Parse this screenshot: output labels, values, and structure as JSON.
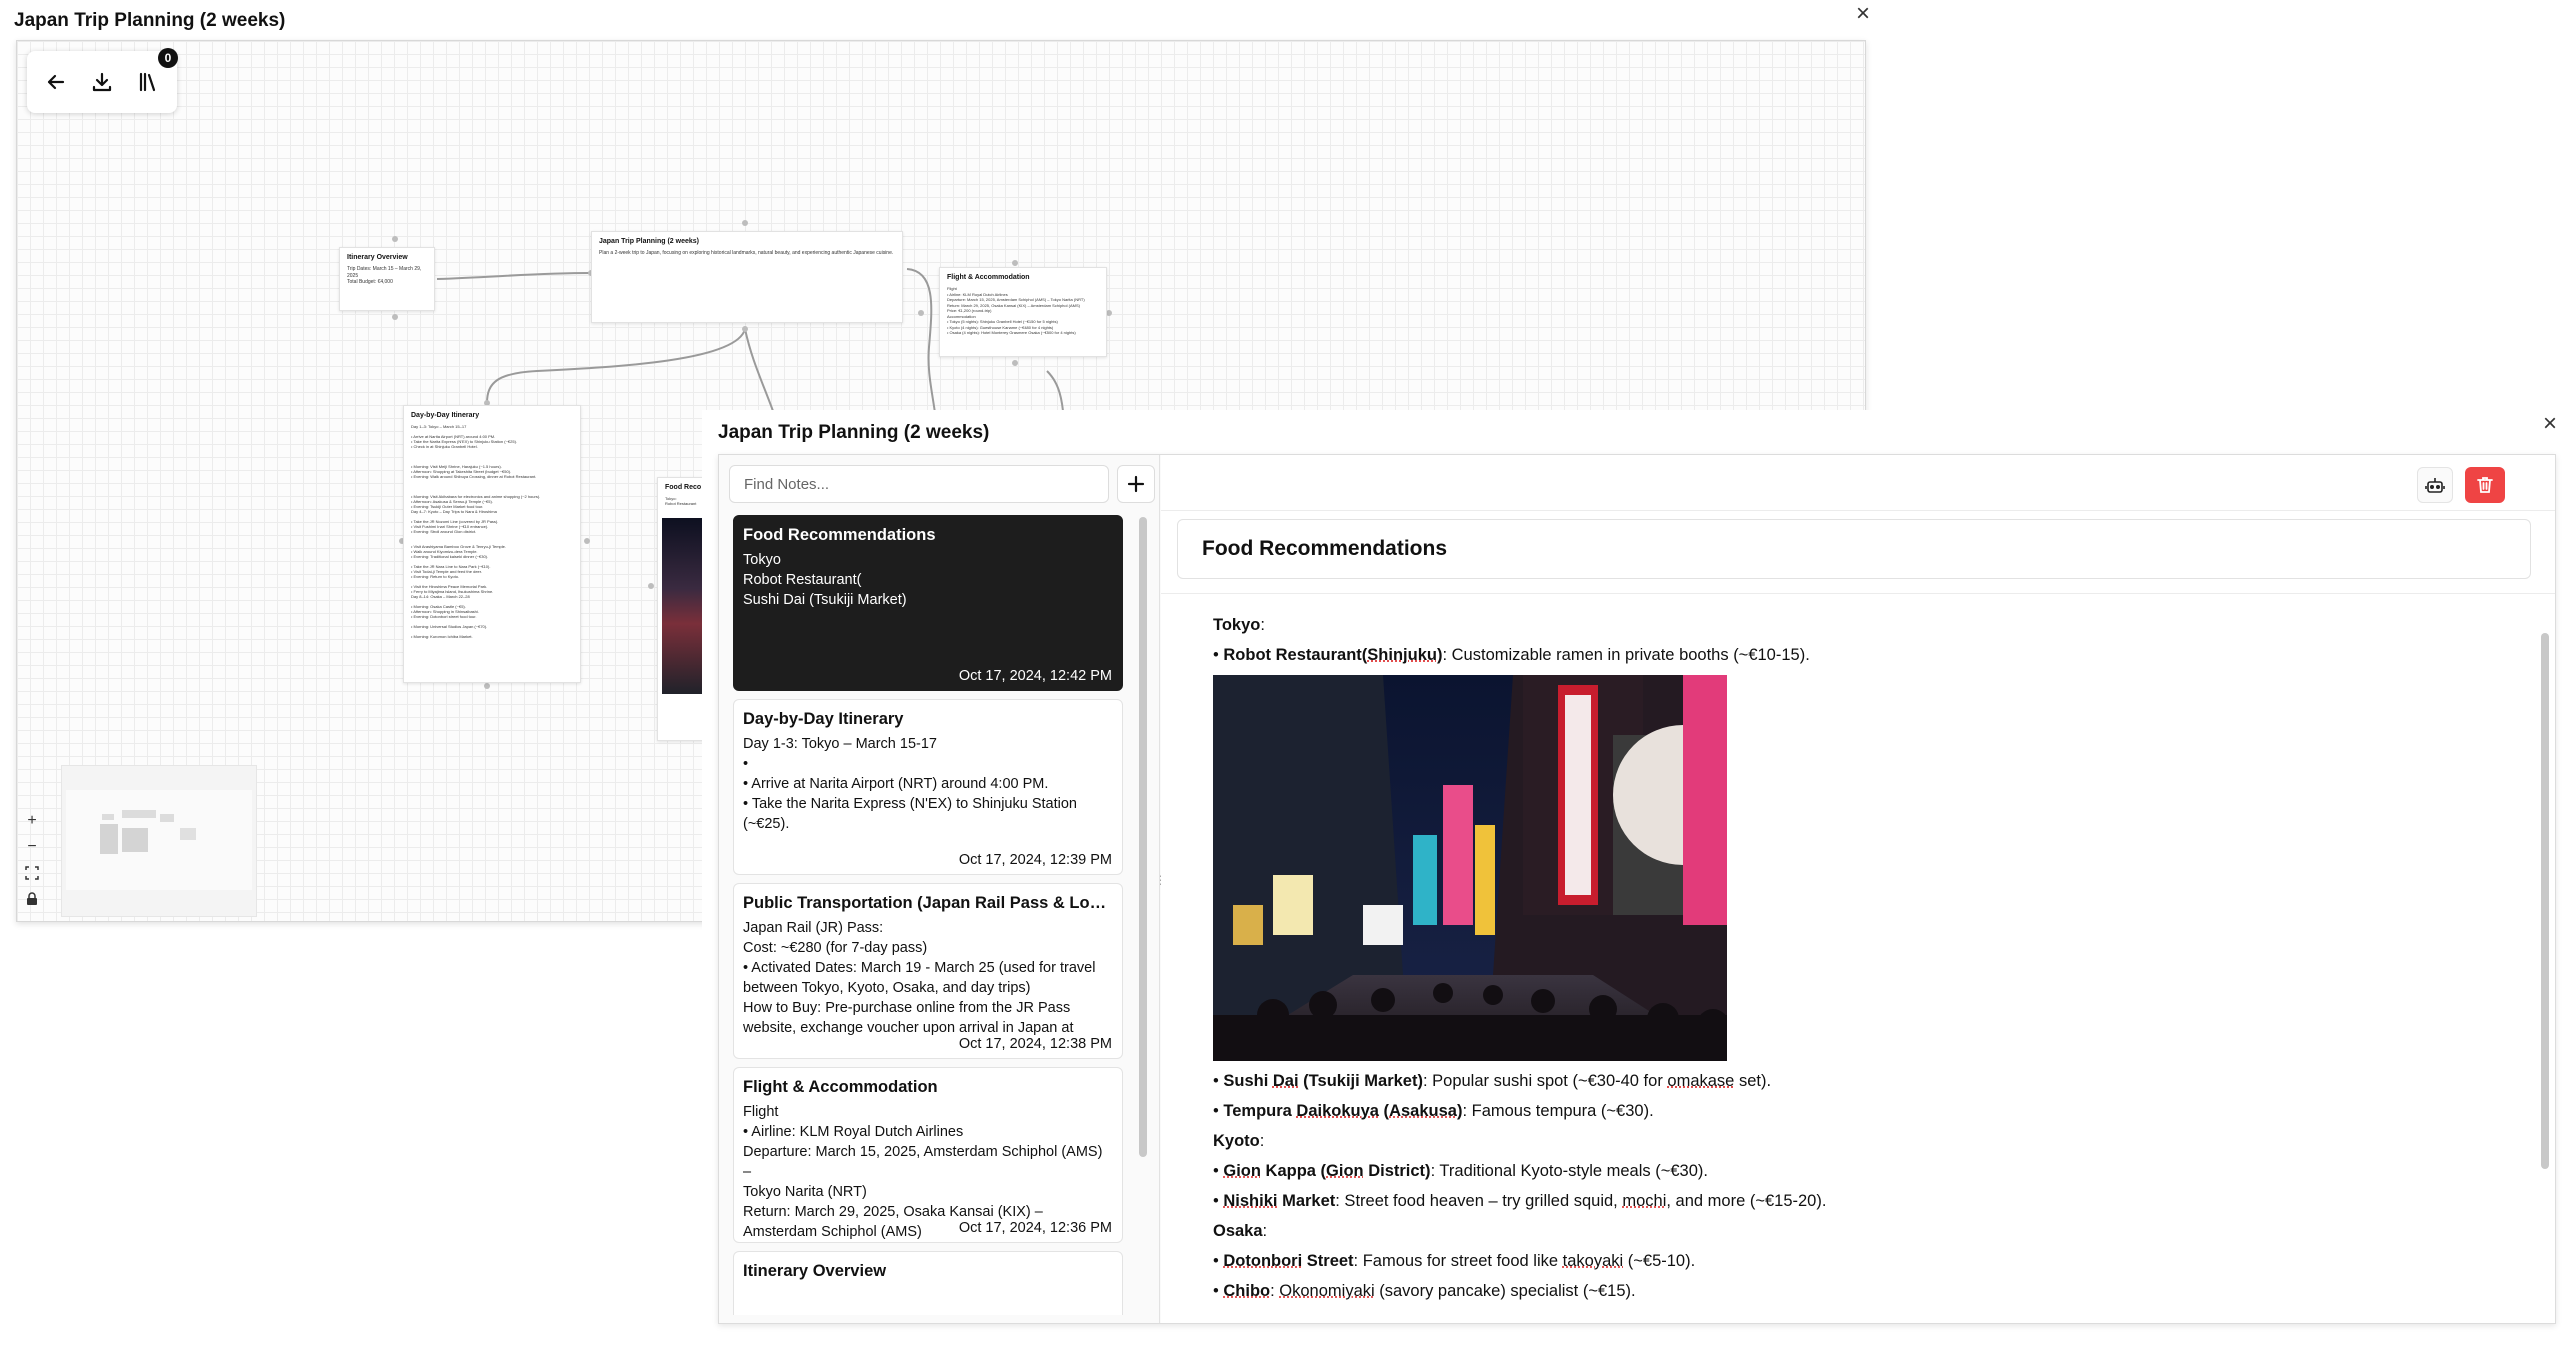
{
  "canvas": {
    "title": "Japan Trip Planning (2 weeks)",
    "close_icon": "×",
    "library_count": "0",
    "nodes": {
      "overview": {
        "title": "Itinerary Overview",
        "body": "Trip Dates: March 15 – March 29, 2025\nTotal Budget: €4,000"
      },
      "main": {
        "title": "Japan Trip Planning (2 weeks)",
        "body": "Plan a 2-week trip to Japan, focusing on exploring historical landmarks, natural beauty, and experiencing authentic Japanese cuisine."
      },
      "flight": {
        "title": "Flight & Accommodation",
        "body": "Flight\n• Airline: KLM Royal Dutch Airlines\nDeparture: March 15, 2025, Amsterdam Schiphol (AMS) – Tokyo Narita (NRT)\nReturn: March 29, 2025, Osaka Kansai (KIX) – Amsterdam Schiphol (AMS)\nPrice: €1,200 (round-trip)\nAccommodation\n• Tokyo (5 nights): Shinjuku Granbell Hotel (~€150 for 5 nights)\n• Kyoto (4 nights): Guesthouse Kaname (~€480 for 4 nights)\n• Osaka (4 nights): Hotel Monterey Grasmere Osaka (~€500 for 4 nights)"
      },
      "daybyday": {
        "title": "Day-by-Day Itinerary",
        "body": "Day 1–3: Tokyo – March 15–17\n\n• Arrive at Narita Airport (NRT) around 4:00 PM.\n• Take the Narita Express (N'EX) to Shinjuku Station (~€25).\n• Check in at Shinjuku Granbell Hotel.\n\n\n\n• Morning: Visit Meiji Shrine, Harajuku (~1.5 hours).\n• Afternoon: Shopping at Takeshita Street (budget ~€50).\n• Evening: Walk around Shibuya Crossing, dinner at Robot Restaurant.\n\n\n\n• Morning: Visit Akihabara for electronics and anime shopping (~2 hours).\n• Afternoon: Asakusa & Senso-ji Temple (~€5).\n• Evening: Tsukiji Outer Market food tour.\nDay 4–7: Kyoto – Day Trips to Nara & Hiroshima\n\n• Take the JR Nozomi Line (covered by JR Pass).\n• Visit Fushimi Inari Shrine (~€10 entrance).\n• Evening: Stroll around Gion district.\n\n\n• Visit Arashiyama Bamboo Grove & Tenryu-ji Temple.\n• Walk around Kiyomizu-dera Temple.\n• Evening: Traditional kaiseki dinner (~€30).\n\n• Take the JR Nara Line to Nara Park (~€10).\n• Visit Todai-ji Temple and feed the deer.\n• Evening: Return to Kyoto.\n\n• Visit the Hiroshima Peace Memorial Park.\n• Ferry to Miyajima Island, Itsukushima Shrine.\nDay 8–14: Osaka – March 22–28\n\n• Morning: Osaka Castle (~€5).\n• Afternoon: Shopping in Shinsaibashi.\n• Evening: Dotonbori street food tour.\n\n• Morning: Universal Studios Japan (~€70).\n\n• Morning: Kuromon Ichiba Market."
      },
      "food": {
        "title": "Food Reco",
        "body": "Tokyo:\nRobot Restaurant\n\n\n\n\n\n\n\n\n\n\n\n\n\n\n\n\nSushi Dai (Tsukiji Market)\nTempura Daikokuya (Asakusa)"
      }
    }
  },
  "notes": {
    "title": "Japan Trip Planning (2 weeks)",
    "close_icon": "×",
    "search_placeholder": "Find Notes...",
    "cards": [
      {
        "title": "Food Recommendations",
        "lines": [
          "Tokyo",
          "Robot Restaurant(",
          "Sushi Dai (Tsukiji Market)"
        ],
        "date": "Oct 17, 2024, 12:42 PM",
        "active": true
      },
      {
        "title": "Day-by-Day Itinerary",
        "lines": [
          "Day 1-3: Tokyo – March 15-17",
          "•",
          "• Arrive at Narita Airport (NRT) around 4:00 PM.",
          "• Take the Narita Express (N'EX) to Shinjuku Station",
          "(~€25)."
        ],
        "date": "Oct 17, 2024, 12:39 PM",
        "active": false
      },
      {
        "title": "Public Transportation (Japan Rail Pass & Local Transit)",
        "lines": [
          "Japan Rail (JR) Pass:",
          "Cost: ~€280 (for 7-day pass)",
          "• Activated Dates: March 19 - March 25 (used for travel",
          "between Tokyo, Kyoto, Osaka, and day trips)",
          "How to Buy: Pre-purchase online from the JR Pass",
          "website, exchange voucher upon arrival in Japan at"
        ],
        "date": "Oct 17, 2024, 12:38 PM",
        "active": false
      },
      {
        "title": "Flight & Accommodation",
        "lines": [
          "Flight",
          "• Airline: KLM Royal Dutch Airlines",
          "Departure: March 15, 2025, Amsterdam Schiphol (AMS) –",
          "Tokyo Narita (NRT)",
          "Return: March 29, 2025, Osaka Kansai (KIX) –",
          "Amsterdam Schiphol (AMS)"
        ],
        "date": "Oct 17, 2024, 12:36 PM",
        "active": false
      },
      {
        "title": "Itinerary Overview",
        "lines": [],
        "date": "",
        "active": false
      }
    ],
    "editor": {
      "title": "Food Recommendations",
      "tokyo_heading": "Tokyo",
      "robot_name": "Robot Restaurant(",
      "robot_area": "Shinjuku",
      "robot_close": ")",
      "robot_desc": ":  Customizable ramen in private booths (~€10-15).",
      "sushi_a": "Sushi ",
      "sushi_b": "Dai",
      "sushi_c": " (Tsukiji Market)",
      "sushi_desc_a": ": Popular sushi spot (~€30-40 for ",
      "sushi_desc_b": "omakase",
      "sushi_desc_c": " set).",
      "tempura_a": "Tempura ",
      "tempura_b": "Daikokuya",
      "tempura_c": " (",
      "tempura_d": "Asakusa",
      "tempura_e": ")",
      "tempura_desc": ": Famous tempura (~€30).",
      "kyoto_heading": "Kyoto",
      "gion_a": "Gion",
      "gion_b": " Kappa (",
      "gion_c": "Gion",
      "gion_d": " District)",
      "gion_desc": ": Traditional Kyoto-style meals (~€30).",
      "nishiki_a": "Nishiki",
      "nishiki_b": " Market",
      "nishiki_desc_a": ": Street food heaven – try grilled squid, ",
      "nishiki_desc_b": "mochi",
      "nishiki_desc_c": ", and more (~€15-20).",
      "osaka_heading": "Osaka",
      "dotonbori_a": "Dotonbori",
      "dotonbori_b": " Street",
      "dotonbori_desc_a": ": Famous for street food like ",
      "dotonbori_desc_b": "takoyaki",
      "dotonbori_desc_c": " (~€5-10).",
      "chibo_a": "Chibo",
      "chibo_desc_a": ": ",
      "chibo_desc_b": "Okonomiyaki",
      "chibo_desc_c": " (savory pancake) specialist (~€15)."
    }
  },
  "icons": [
    "back-arrow-icon",
    "download-icon",
    "library-icon",
    "plus-icon",
    "robot-icon",
    "trash-icon",
    "close-icon",
    "zoom-in-icon",
    "zoom-out-icon",
    "fit-view-icon",
    "lock-icon"
  ],
  "colors": {
    "danger": "#ef4444",
    "active_card": "#1d1d1d",
    "grid": "#ececec"
  }
}
